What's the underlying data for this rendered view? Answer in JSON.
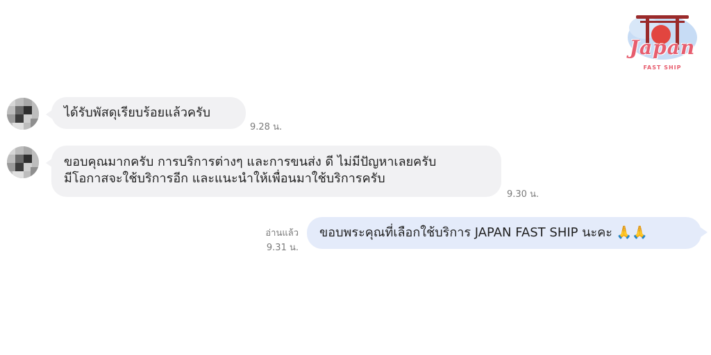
{
  "logo": {
    "word": "Japan",
    "sub": "FAST SHIP",
    "colors": {
      "pink": "#e75d6e",
      "sky": "#c7dcf5",
      "red": "#e2453f"
    }
  },
  "messages": [
    {
      "side": "in",
      "lines": [
        "ได้รับพัสดุเรียบร้อยแล้วครับ"
      ],
      "time": "9.28 น."
    },
    {
      "side": "in",
      "lines": [
        "ขอบคุณมากครับ การบริการต่างๆ และการขนส่ง ดี ไม่มีปัญหาเลยครับ",
        "มีโอกาสจะใช้บริการอีก และแนะนำให้เพื่อนมาใช้บริการครับ"
      ],
      "time": "9.30 น."
    },
    {
      "side": "out",
      "lines": [
        "ขอบพระคุณที่เลือกใช้บริการ JAPAN FAST SHIP นะคะ 🙏🙏"
      ],
      "read": "อ่านแล้ว",
      "time": "9.31 น."
    }
  ],
  "colors": {
    "incoming_bubble": "#f1f1f3",
    "outgoing_bubble": "#e4ebfa",
    "timestamp": "#7a7a7a"
  }
}
